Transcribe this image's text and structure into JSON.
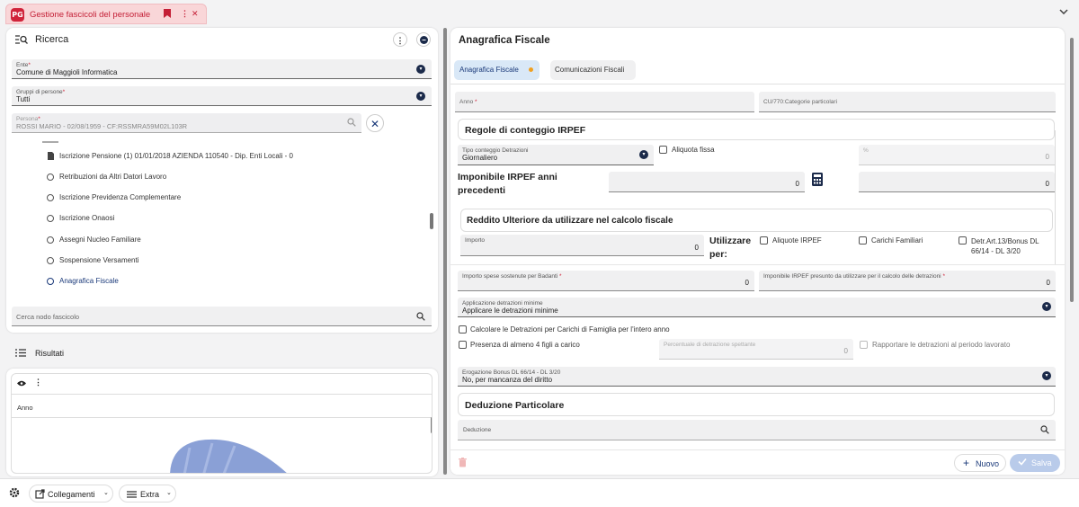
{
  "tab": {
    "title": "Gestione fascicoli del personale",
    "logo": "PG",
    "bookmark_icon": "bookmark-icon",
    "menu_icon": "more-vert-icon",
    "close_glyph": "✕",
    "collapse_glyph": "⌄"
  },
  "search": {
    "title": "Ricerca",
    "ente": {
      "label": "Ente",
      "value": "Comune di Maggioli Informatica"
    },
    "gruppi": {
      "label": "Gruppi di persone",
      "value": "Tutti"
    },
    "persona": {
      "label": "Persona",
      "value": "ROSSI MARIO - 02/08/1959 - CF:RSSMRA59M02L103R"
    },
    "tree": [
      {
        "label": "Iscrizione Pensione (1) 01/01/2018 AZIENDA 110540 - Dip. Enti Locali - 0",
        "icon": "document-icon"
      },
      {
        "label": "Retribuzioni da Altri Datori Lavoro",
        "icon": "circle-icon"
      },
      {
        "label": "Iscrizione Previdenza Complementare",
        "icon": "circle-icon"
      },
      {
        "label": "Iscrizione Onaosi",
        "icon": "circle-icon"
      },
      {
        "label": "Assegni Nucleo Familiare",
        "icon": "circle-icon"
      },
      {
        "label": "Sospensione Versamenti",
        "icon": "circle-icon"
      },
      {
        "label": "Anagrafica Fiscale",
        "icon": "circle-icon",
        "active": true
      }
    ],
    "search_node_placeholder": "Cerca nodo fascicolo"
  },
  "results": {
    "title": "Risultati",
    "column": "Anno"
  },
  "footer": {
    "collegamenti": "Collegamenti",
    "extra": "Extra"
  },
  "form": {
    "title": "Anagrafica Fiscale",
    "tabs": [
      "Anagrafica Fiscale",
      "Comunicazioni Fiscali"
    ],
    "anno_label": "Anno",
    "cu_label": "CU/770:Categorie particolari",
    "irpef": {
      "title": "Regole di conteggio IRPEF",
      "tipo_label": "Tipo conteggio Detrazioni",
      "tipo_value": "Giornaliero",
      "aliquota_label": "Aliquota fissa",
      "percent_label": "%",
      "percent_value": "0",
      "imponibile_label": "Imponibile IRPEF anni precedenti",
      "imponibile_value": "0",
      "imponibile_value2": "0"
    },
    "reddito": {
      "title": "Reddito Ulteriore da utilizzare nel calcolo fiscale",
      "importo_label": "Importo",
      "importo_value": "0",
      "utilizzare_label": "Utilizzare per:",
      "checks": [
        "Aliquote IRPEF",
        "Carichi Familiari",
        "Detr.Art.13/Bonus DL 66/14 - DL 3/20"
      ]
    },
    "badanti": {
      "label": "Importo spese sostenute per Badanti",
      "value": "0"
    },
    "imponibile_presunto": {
      "label": "Imponibile IRPEF presunto da utilizzare per il calcolo delle detrazioni",
      "value": "0"
    },
    "applicazione": {
      "label": "Applicazione detrazioni minime",
      "value": "Applicare le detrazioni minime"
    },
    "calcolare_label": "Calcolare le Detrazioni per Carichi di Famiglia per l'intero anno",
    "presenza_label": "Presenza di almeno 4 figli a carico",
    "percentuale": {
      "label": "Percentuale di detrazione spettante",
      "value": "0"
    },
    "rapportare_label": "Rapportare le detrazioni al periodo lavorato",
    "erogazione": {
      "label": "Erogazione Bonus DL 66/14 - DL 3/20",
      "value": "No, per mancanza del diritto"
    },
    "deduzione": {
      "title": "Deduzione Particolare",
      "label": "Deduzione"
    },
    "nuovo": "Nuovo",
    "salva": "Salva"
  }
}
